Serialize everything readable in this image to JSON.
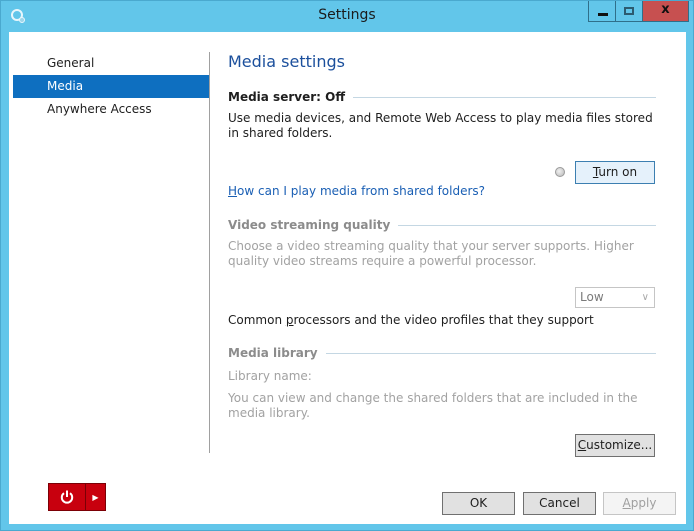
{
  "window": {
    "title": "Settings",
    "controls": {
      "minimize": "minimize",
      "maximize": "maximize",
      "close": "x"
    }
  },
  "sidebar": {
    "items": [
      {
        "label": "General",
        "selected": false
      },
      {
        "label": "Media",
        "selected": true
      },
      {
        "label": "Anywhere Access",
        "selected": false
      }
    ]
  },
  "main": {
    "heading": "Media settings",
    "media_server": {
      "title": "Media server: Off",
      "description": "Use media devices, and Remote Web Access to play media files stored in shared folders.",
      "status_indicator": "off",
      "turn_on_prefix": "T",
      "turn_on_rest": "urn on",
      "help_link_prefix": "H",
      "help_link_rest": "ow can I play media from shared folders?"
    },
    "video_streaming": {
      "title": "Video streaming quality",
      "description": "Choose a video streaming quality that your server supports. Higher quality video streams require a powerful processor.",
      "quality_selected": "Low",
      "processors_link_a": "Common ",
      "processors_link_u": "p",
      "processors_link_b": "rocessors and the video profiles that they support"
    },
    "media_library": {
      "title": "Media library",
      "library_name_label": "Library name:",
      "description": "You can view and change the shared folders that are included in the media library.",
      "customize_prefix": "C",
      "customize_rest": "ustomize..."
    }
  },
  "footer": {
    "ok_label": "OK",
    "cancel_label": "Cancel",
    "apply_prefix": "A",
    "apply_rest": "pply"
  },
  "colors": {
    "title_bar": "#62c6ea",
    "close_button": "#c75050",
    "selected_nav": "#0e6fc0",
    "heading": "#1b4f9c",
    "power_button": "#c8000e"
  }
}
